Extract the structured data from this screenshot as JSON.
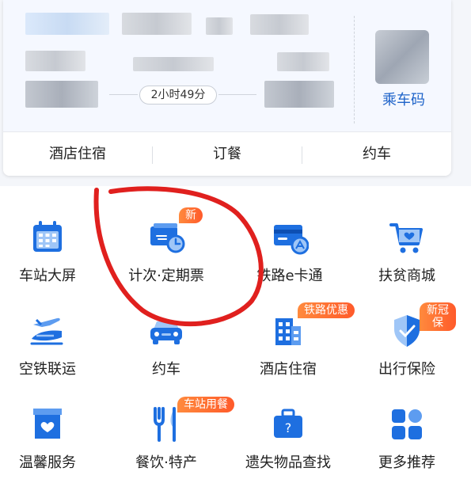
{
  "trip": {
    "duration": "2小时49分",
    "ride_code_label": "乘车码"
  },
  "sublinks": [
    {
      "label": "酒店住宿"
    },
    {
      "label": "订餐"
    },
    {
      "label": "约车"
    }
  ],
  "services": [
    {
      "label": "车站大屏",
      "icon": "calendar-icon"
    },
    {
      "label": "计次·定期票",
      "icon": "ticket-card-icon",
      "badge": "新"
    },
    {
      "label": "铁路e卡通",
      "icon": "railway-card-icon"
    },
    {
      "label": "扶贫商城",
      "icon": "shopping-cart-icon"
    },
    {
      "label": "空铁联运",
      "icon": "plane-train-icon"
    },
    {
      "label": "约车",
      "icon": "car-icon"
    },
    {
      "label": "酒店住宿",
      "icon": "hotel-icon",
      "badge": "铁路优惠"
    },
    {
      "label": "出行保险",
      "icon": "shield-icon",
      "badge": "新冠\n保"
    },
    {
      "label": "温馨服务",
      "icon": "heart-service-icon"
    },
    {
      "label": "餐饮·特产",
      "icon": "fork-knife-icon",
      "badge": "车站用餐"
    },
    {
      "label": "遗失物品查找",
      "icon": "lost-bag-icon"
    },
    {
      "label": "更多推荐",
      "icon": "more-grid-icon"
    }
  ],
  "colors": {
    "primary_blue": "#1e6fe0",
    "badge_orange": "#ff6a2c",
    "annotation_red": "#e0201e"
  }
}
